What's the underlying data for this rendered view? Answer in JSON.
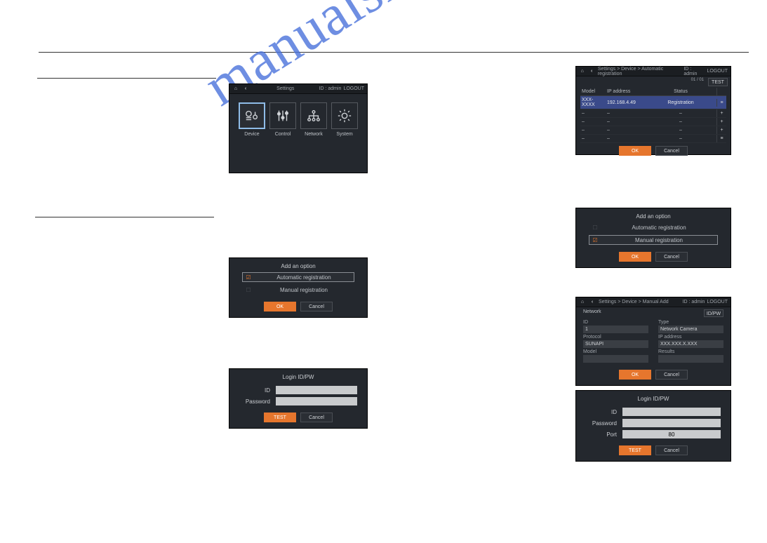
{
  "watermark": "manualshive.com",
  "common": {
    "home_icon": "⌂",
    "back_icon": "‹",
    "user_prefix": "ID : ",
    "user": "admin",
    "logout": "LOGOUT",
    "ok": "OK",
    "cancel": "Cancel",
    "test": "TEST"
  },
  "settings_panel": {
    "title": "Settings",
    "tiles": [
      {
        "id": "device",
        "label": "Device"
      },
      {
        "id": "control",
        "label": "Control"
      },
      {
        "id": "network",
        "label": "Network"
      },
      {
        "id": "system",
        "label": "System"
      }
    ]
  },
  "add_option_auto": {
    "title": "Add an option",
    "opts": [
      "Automatic registration",
      "Manual registration"
    ],
    "selected": 0
  },
  "add_option_manual": {
    "title": "Add an option",
    "opts": [
      "Automatic registration",
      "Manual registration"
    ],
    "selected": 1
  },
  "login1": {
    "title": "Login ID/PW",
    "id_label": "ID",
    "pw_label": "Password"
  },
  "login2": {
    "title": "Login ID/PW",
    "id_label": "ID",
    "pw_label": "Password",
    "port_label": "Port",
    "port_value": "80"
  },
  "auto_reg": {
    "breadcrumb": "Settings > Device > Automatic registration",
    "cols": [
      "Model",
      "IP address",
      "Status"
    ],
    "page": "01 / 01",
    "rows": [
      {
        "model": "XXX-XXXX",
        "ip": "192.168.4.49",
        "status": "Registration",
        "selected": true
      },
      {
        "model": "–",
        "ip": "–",
        "status": "–"
      },
      {
        "model": "–",
        "ip": "–",
        "status": "–"
      },
      {
        "model": "–",
        "ip": "–",
        "status": "–"
      },
      {
        "model": "–",
        "ip": "–",
        "status": "–"
      }
    ]
  },
  "manual_add": {
    "breadcrumb": "Settings > Device > Manual Add",
    "tab_network": "Network",
    "tab_idpw": "ID/PW",
    "fields": {
      "id_label": "ID",
      "id_value": "1",
      "type_label": "Type",
      "type_value": "Network Camera",
      "protocol_label": "Protocol",
      "protocol_value": "SUNAPI",
      "ip_label": "IP address",
      "ip_value": "XXX.XXX.X.XXX",
      "model_label": "Model",
      "model_value": "",
      "results_label": "Results",
      "results_value": ""
    }
  }
}
